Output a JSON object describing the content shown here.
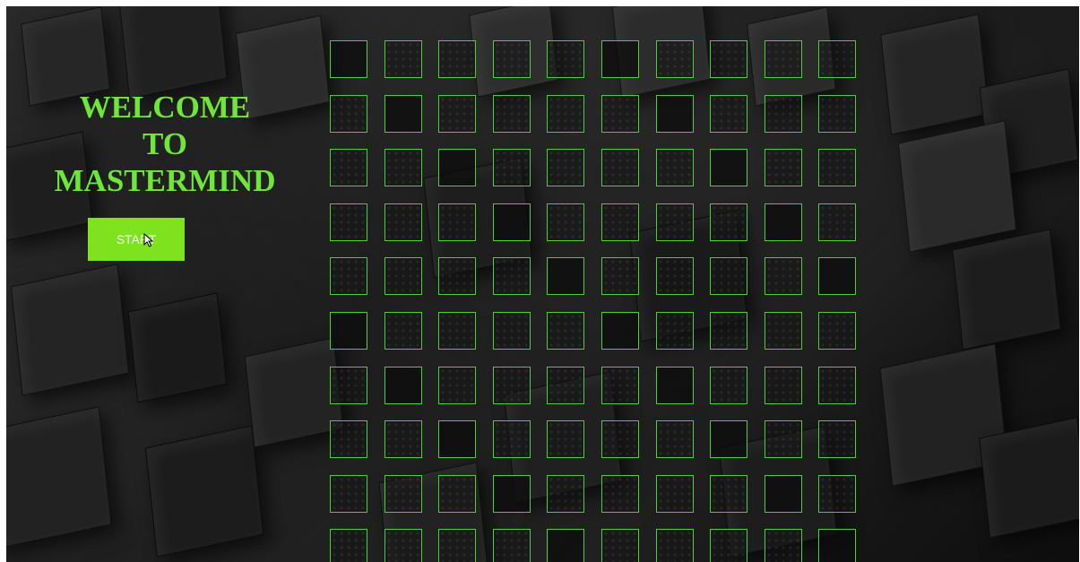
{
  "welcome": {
    "line1": "WELCOME",
    "line2": "TO",
    "line3": "MASTERMIND"
  },
  "start_button": {
    "label": "START"
  },
  "board": {
    "columns": 10,
    "visible_rows": 10
  },
  "colors": {
    "accent_green": "#6ee63a",
    "button_green": "#7ee21f",
    "cell_border": "#4fcf2d",
    "background": "#1a1a1a"
  }
}
